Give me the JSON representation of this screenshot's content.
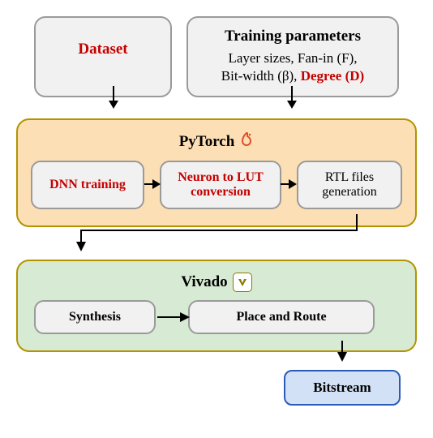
{
  "inputs": {
    "dataset_label": "Dataset",
    "params_title": "Training parameters",
    "params_line1": "Layer sizes, Fan-in (F),",
    "params_bitwidth": "Bit-width (β), ",
    "params_degree": "Degree (D)"
  },
  "pytorch": {
    "title": "PyTorch",
    "dnn": "DNN training",
    "lut": "Neuron to LUT conversion",
    "rtl": "RTL files generation"
  },
  "vivado": {
    "title": "Vivado",
    "synthesis": "Synthesis",
    "par": "Place and Route"
  },
  "output": {
    "bitstream": "Bitstream"
  },
  "chart_data": {
    "type": "flow",
    "nodes": [
      {
        "id": "dataset",
        "label": "Dataset",
        "group": "input",
        "highlight": true
      },
      {
        "id": "params",
        "label": "Training parameters",
        "group": "input",
        "details": [
          "Layer sizes",
          "Fan-in (F)",
          "Bit-width (β)",
          "Degree (D)"
        ],
        "highlight_fields": [
          "Degree (D)"
        ]
      },
      {
        "id": "dnn",
        "label": "DNN training",
        "group": "pytorch",
        "highlight": true
      },
      {
        "id": "lut",
        "label": "Neuron to LUT conversion",
        "group": "pytorch",
        "highlight": true
      },
      {
        "id": "rtl",
        "label": "RTL files generation",
        "group": "pytorch",
        "highlight": false
      },
      {
        "id": "syn",
        "label": "Synthesis",
        "group": "vivado"
      },
      {
        "id": "par",
        "label": "Place and Route",
        "group": "vivado"
      },
      {
        "id": "bit",
        "label": "Bitstream",
        "group": "output"
      }
    ],
    "edges": [
      {
        "from": "dataset",
        "to": "pytorch_stage"
      },
      {
        "from": "params",
        "to": "pytorch_stage"
      },
      {
        "from": "dnn",
        "to": "lut"
      },
      {
        "from": "lut",
        "to": "rtl"
      },
      {
        "from": "rtl",
        "to": "vivado_stage"
      },
      {
        "from": "syn",
        "to": "par"
      },
      {
        "from": "par",
        "to": "bit"
      }
    ],
    "stages": [
      {
        "id": "pytorch_stage",
        "label": "PyTorch",
        "color": "#fcdfb4"
      },
      {
        "id": "vivado_stage",
        "label": "Vivado",
        "color": "#d7ead3"
      }
    ]
  }
}
